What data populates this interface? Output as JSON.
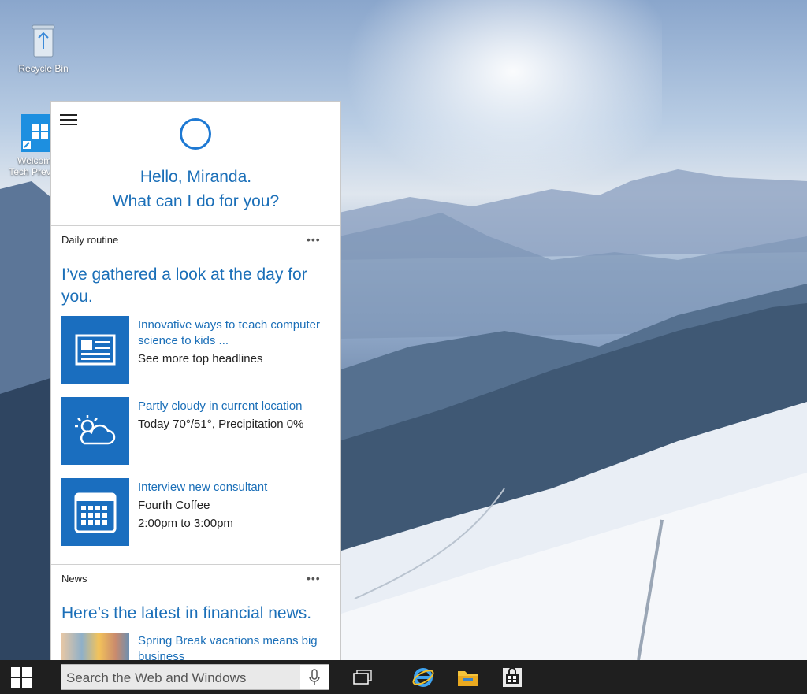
{
  "desktop": {
    "icons": [
      {
        "label": "Recycle Bin"
      },
      {
        "label": "Welcome Tech Preview"
      }
    ]
  },
  "cortana": {
    "greeting_line1": "Hello, Miranda.",
    "greeting_line2": "What can I do for you?",
    "daily": {
      "label": "Daily routine",
      "more": "•••",
      "heading": "I’ve gathered a look at the day for you.",
      "cards": [
        {
          "icon": "newspaper-icon",
          "line1": "Innovative ways to teach computer science to kids ...",
          "line2": "See more top headlines",
          "line3": ""
        },
        {
          "icon": "partly-cloudy-icon",
          "line1": "Partly cloudy in current location",
          "line2": "Today 70°/51°, Precipitation 0%",
          "line3": ""
        },
        {
          "icon": "calendar-icon",
          "line1": "Interview new consultant",
          "line2": "Fourth Coffee",
          "line3": "2:00pm to 3:00pm"
        }
      ]
    },
    "news": {
      "label": "News",
      "more": "•••",
      "heading": "Here’s the latest in financial news.",
      "item_title": "Spring Break vacations means big business"
    }
  },
  "taskbar": {
    "search_placeholder": "Search the Web and Windows",
    "icons": [
      "windows-start-icon",
      "task-view-icon",
      "internet-explorer-icon",
      "file-explorer-icon",
      "store-icon"
    ]
  },
  "colors": {
    "accent": "#1a6ebf",
    "link_text": "#1b6fb8",
    "taskbar": "#1f1f1f"
  }
}
